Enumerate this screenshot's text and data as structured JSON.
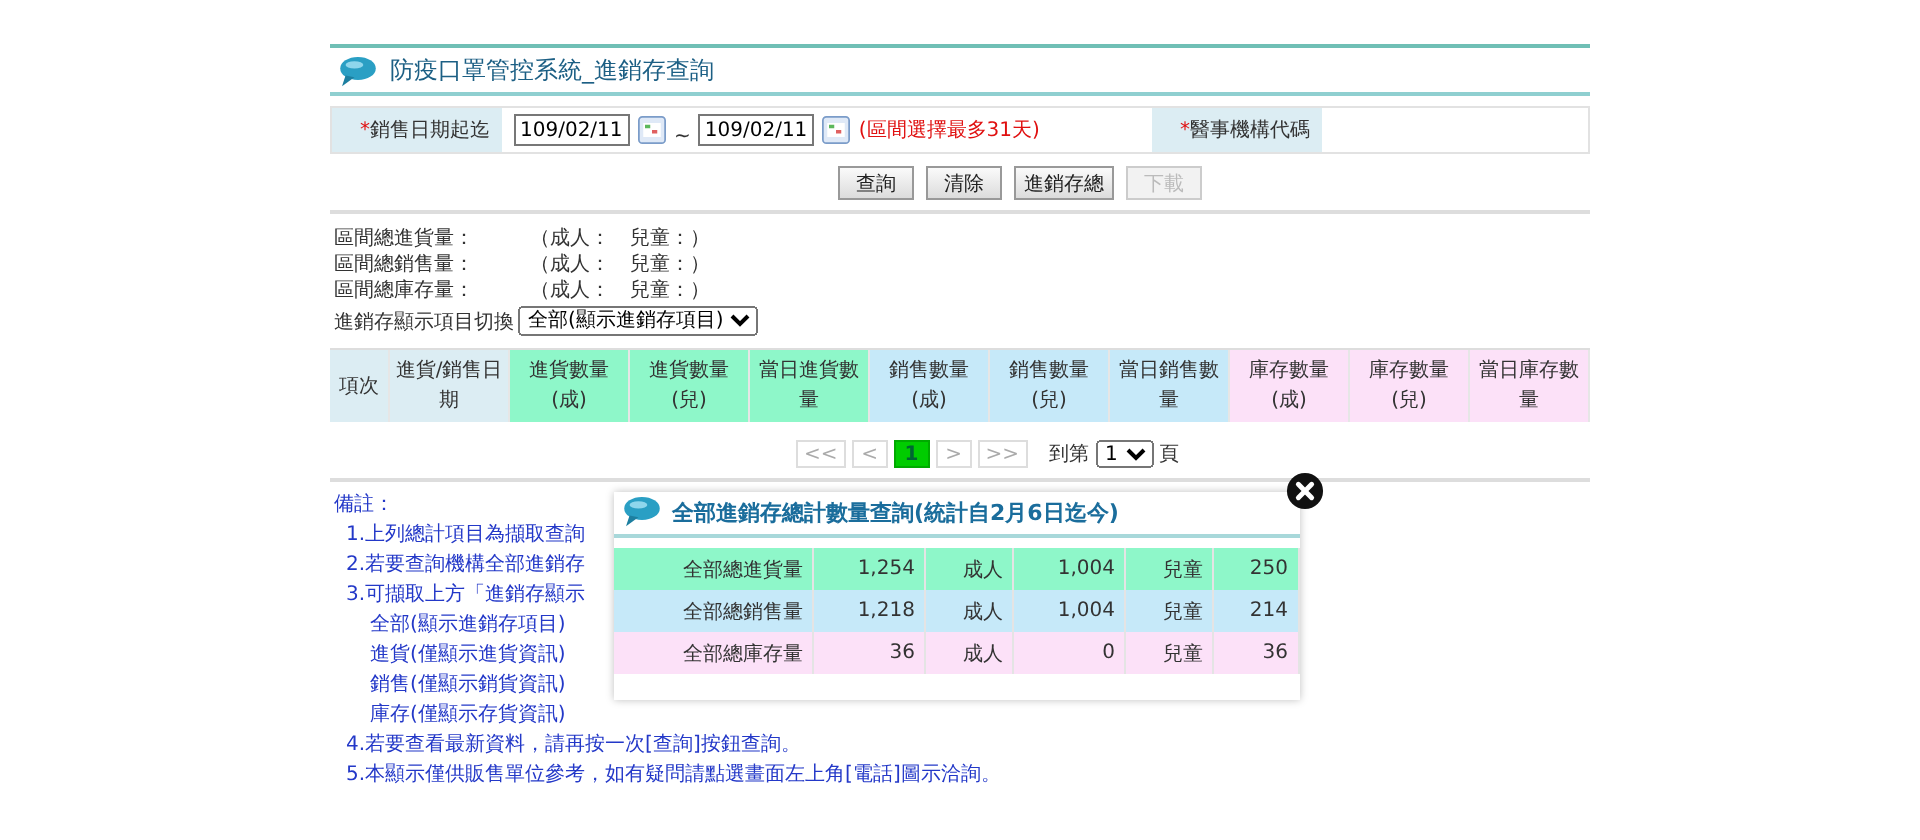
{
  "header": {
    "title": "防疫口罩管控系統_進銷存查詢"
  },
  "form": {
    "fields": [
      {
        "required_mark": "*",
        "label": "銷售日期起迄",
        "kind": "daterange",
        "from": "109/02/11",
        "separator": "~",
        "to": "109/02/11",
        "hint": "(區間選擇最多31天)"
      },
      {
        "required_mark": "*",
        "label": "醫事機構代碼",
        "kind": "empty"
      }
    ]
  },
  "buttons": [
    {
      "label": "查詢",
      "disabled": false
    },
    {
      "label": "清除",
      "disabled": false
    },
    {
      "label": "進銷存總",
      "disabled": false
    },
    {
      "label": "下載",
      "disabled": true
    }
  ],
  "summary": {
    "lines": [
      {
        "label": "區間總進貨量：",
        "adult": "（成人：",
        "child": "兒童：）"
      },
      {
        "label": "區間總銷售量：",
        "adult": "（成人：",
        "child": "兒童：）"
      },
      {
        "label": "區間總庫存量：",
        "adult": "（成人：",
        "child": "兒童：）"
      }
    ],
    "switch_label": "進銷存顯示項目切換",
    "switch_value": "全部(顯示進銷存項目)"
  },
  "table": {
    "columns": [
      {
        "label": "項次",
        "color": "#dcedf3"
      },
      {
        "label": "進貨/銷售日期",
        "color": "#dcedf3"
      },
      {
        "label": "進貨數量(成)",
        "color": "#8ef7c9"
      },
      {
        "label": "進貨數量(兒)",
        "color": "#8ef7c9"
      },
      {
        "label": "當日進貨數量",
        "color": "#8ef7c9"
      },
      {
        "label": "銷售數量(成)",
        "color": "#c6e9f9"
      },
      {
        "label": "銷售數量(兒)",
        "color": "#c6e9f9"
      },
      {
        "label": "當日銷售數量",
        "color": "#c6e9f9"
      },
      {
        "label": "庫存數量(成)",
        "color": "#fce1f8"
      },
      {
        "label": "庫存數量(兒)",
        "color": "#fce1f8"
      },
      {
        "label": "當日庫存數量",
        "color": "#fce1f8"
      }
    ]
  },
  "pager": {
    "first": "<<",
    "prev": "<",
    "pages": [
      {
        "label": "1",
        "selected": true
      }
    ],
    "next": ">",
    "last": ">>",
    "goto_label": "到第",
    "goto_value": "1",
    "goto_suffix": "頁"
  },
  "notes": {
    "title": "備註：",
    "items": [
      {
        "text": "1.上列總計項目為擷取查詢"
      },
      {
        "text": "2.若要查詢機構全部進銷存"
      },
      {
        "text": "3.可擷取上方「進銷存顯示",
        "children": [
          {
            "text": "全部(顯示進銷存項目)"
          },
          {
            "text": "進貨(僅顯示進貨資訊)"
          },
          {
            "text": "銷售(僅顯示銷貨資訊)"
          },
          {
            "text": "庫存(僅顯示存貨資訊)"
          }
        ]
      },
      {
        "text": "4.若要查看最新資料，請再按一次[查詢]按鈕查詢。"
      },
      {
        "text": "5.本顯示僅供販售單位參考，如有疑問請點選畫面左上角[電話]圖示洽詢。"
      }
    ]
  },
  "popup": {
    "title": "全部進銷存總計數量查詢(統計自2月6日迄今)",
    "rows": [
      {
        "label": "全部總進貨量",
        "total": "1,254",
        "adult_label": "成人",
        "adult": "1,004",
        "child_label": "兒童",
        "child": "250",
        "color": "#8ef7c9"
      },
      {
        "label": "全部總銷售量",
        "total": "1,218",
        "adult_label": "成人",
        "adult": "1,004",
        "child_label": "兒童",
        "child": "214",
        "color": "#c6e9f9"
      },
      {
        "label": "全部總庫存量",
        "total": "36",
        "adult_label": "成人",
        "adult": "0",
        "child_label": "兒童",
        "child": "36",
        "color": "#fce1f8"
      }
    ]
  }
}
